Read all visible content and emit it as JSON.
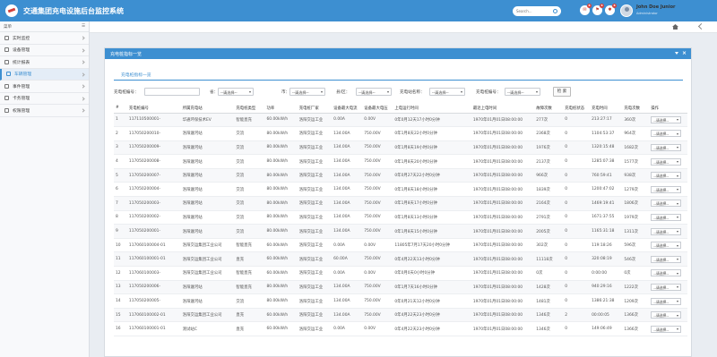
{
  "app": {
    "title": "交通集团充电设施后台监控系统"
  },
  "header": {
    "search_placeholder": "Search...",
    "notif_counts": [
      "8",
      "8",
      "8"
    ],
    "user_name": "John Doe Junior",
    "user_role": "Administrator"
  },
  "sidebar": {
    "title": "菜单",
    "items": [
      {
        "label": "实时监控",
        "icon": "monitor-icon"
      },
      {
        "label": "设备管理",
        "icon": "device-icon"
      },
      {
        "label": "统计报表",
        "icon": "report-icon"
      },
      {
        "label": "车辆管理",
        "icon": "car-icon",
        "active": true
      },
      {
        "label": "事件管理",
        "icon": "event-icon"
      },
      {
        "label": "卡务管理",
        "icon": "card-icon"
      },
      {
        "label": "权限管理",
        "icon": "users-icon"
      }
    ]
  },
  "panel": {
    "title": "充电桩指标一览",
    "subtab": "充电桩指标一览"
  },
  "filters": {
    "code_label": "充电桩编号：",
    "province_label": "省：",
    "city_label": "市：",
    "district_label": "县/区：",
    "station_label": "充电站名称：",
    "pile_label": "充电桩编号：",
    "select_default": "--请选择--",
    "query_button": "检 索"
  },
  "table": {
    "headers": [
      "#",
      "充电桩编号",
      "所属充电站",
      "充电桩类型",
      "功率",
      "充电桩厂家",
      "设备最大电流",
      "设备最大电压",
      "上电运行时间",
      "最近上电时间",
      "故障次数",
      "充电桩状态",
      "充电时间",
      "充电次数",
      "操作"
    ],
    "rows": [
      [
        "1",
        "117110500001-",
        "华通环保技术EV",
        "智能直充",
        "60.00kW/h",
        "洛阳交运工业",
        "0.00A",
        "0.00V",
        "0年0月12天17小时0分钟",
        "1970年01月01日08:00:00",
        "277次",
        "0",
        "213:27:17",
        "360次"
      ],
      [
        "2",
        "117050200010-",
        "洛阳瀍河站",
        "交流",
        "80.00kW/h",
        "洛阳交运工业",
        "134.00A",
        "750.00V",
        "0年1月8天22小时0分钟",
        "1970年01月01日08:00:00",
        "2368次",
        "0",
        "1104:53:37",
        "964次"
      ],
      [
        "3",
        "117050200009-",
        "洛阳瀍河站",
        "交流",
        "80.00kW/h",
        "洛阳交运工业",
        "134.00A",
        "750.00V",
        "0年1月8天19小时0分钟",
        "1970年01月01日08:00:00",
        "1976次",
        "0",
        "1320:15:48",
        "1682次"
      ],
      [
        "4",
        "117050200008-",
        "洛阳瀍河站",
        "交流",
        "80.00kW/h",
        "洛阳交运工业",
        "134.00A",
        "750.00V",
        "0年1月8天20小时0分钟",
        "1970年01月01日08:00:00",
        "2137次",
        "0",
        "1285:07:38",
        "1577次"
      ],
      [
        "5",
        "117050200007-",
        "洛阳瀍河站",
        "交流",
        "80.00kW/h",
        "洛阳交运工业",
        "134.00A",
        "750.00V",
        "0年0月27天22小时0分钟",
        "1970年01月01日08:00:00",
        "966次",
        "0",
        "760:59:41",
        "938次"
      ],
      [
        "6",
        "117050200004-",
        "洛阳瀍河站",
        "交流",
        "80.00kW/h",
        "洛阳交运工业",
        "134.00A",
        "750.00V",
        "0年1月8天18小时0分钟",
        "1970年01月01日08:00:00",
        "1839次",
        "0",
        "1200:47:02",
        "1279次"
      ],
      [
        "7",
        "117050200003-",
        "洛阳瀍河站",
        "交流",
        "80.00kW/h",
        "洛阳交运工业",
        "134.00A",
        "750.00V",
        "0年1月8天17小时0分钟",
        "1970年01月01日08:00:00",
        "2164次",
        "0",
        "1469:19:41",
        "1806次"
      ],
      [
        "8",
        "117050200002-",
        "洛阳瀍河站",
        "交流",
        "80.00kW/h",
        "洛阳交运工业",
        "134.00A",
        "750.00V",
        "0年1月8天13小时0分钟",
        "1970年01月01日08:00:00",
        "2791次",
        "0",
        "1671:37:55",
        "1979次"
      ],
      [
        "9",
        "117050200001-",
        "洛阳瀍河站",
        "交流",
        "80.00kW/h",
        "洛阳交运工业",
        "134.00A",
        "750.00V",
        "0年1月8天15小时0分钟",
        "1970年01月01日08:00:00",
        "2005次",
        "0",
        "1165:31:18",
        "1311次"
      ],
      [
        "10",
        "117060100004-01",
        "洛阳交运集团工业公司",
        "智能直充",
        "60.00kW/h",
        "洛阳交运工业",
        "0.00A",
        "0.00V",
        "11805年7月17天20小时0分钟",
        "1970年01月01日08:00:00",
        "302次",
        "0",
        "119:18:26",
        "596次"
      ],
      [
        "11",
        "117060100001-01",
        "洛阳交运集团工业公司",
        "直充",
        "60.00kW/h",
        "洛阳交运工业",
        "60.00A",
        "750.00V",
        "0年4月22天13小时0分钟",
        "1970年01月01日08:00:00",
        "11118次",
        "0",
        "320:08:19",
        "546次"
      ],
      [
        "12",
        "117060100003-",
        "洛阳交运集团工业公司",
        "智能直充",
        "60.00kW/h",
        "洛阳交运工业",
        "0.00A",
        "0.00V",
        "0年0月0天0小时0分钟",
        "1970年01月01日08:00:00",
        "0次",
        "0",
        "0:00:00",
        "0次"
      ],
      [
        "13",
        "117050200006-",
        "洛阳瀍河站",
        "智能直充",
        "80.00kW/h",
        "洛阳交运工业",
        "134.00A",
        "750.00V",
        "0年1月7天16小时0分钟",
        "1970年01月01日08:00:00",
        "1428次",
        "0",
        "940:29:16",
        "1222次"
      ],
      [
        "14",
        "117050200005-",
        "洛阳瀍河站",
        "交流",
        "80.00kW/h",
        "洛阳交运工业",
        "134.00A",
        "750.00V",
        "0年0月21天12小时0分钟",
        "1970年01月01日08:00:00",
        "1481次",
        "0",
        "1386:21:38",
        "1209次"
      ],
      [
        "15",
        "117060100002-01",
        "洛阳交运集团工业公司",
        "直充",
        "60.00kW/h",
        "洛阳交运工业",
        "134.00A",
        "750.00V",
        "0年4月22天23小时0分钟",
        "1970年01月01日08:00:00",
        "1346次",
        "2",
        "00:00:05",
        "1366次"
      ],
      [
        "16",
        "117060100001-01",
        "测试站C",
        "直充",
        "60.00kW/h",
        "洛阳交运工业",
        "0.00A",
        "0.00V",
        "0年4月22天23小时0分钟",
        "1970年01月01日08:00:00",
        "1346次",
        "0",
        "149:06:49",
        "1366次"
      ]
    ],
    "action_select": "--请选择--"
  }
}
